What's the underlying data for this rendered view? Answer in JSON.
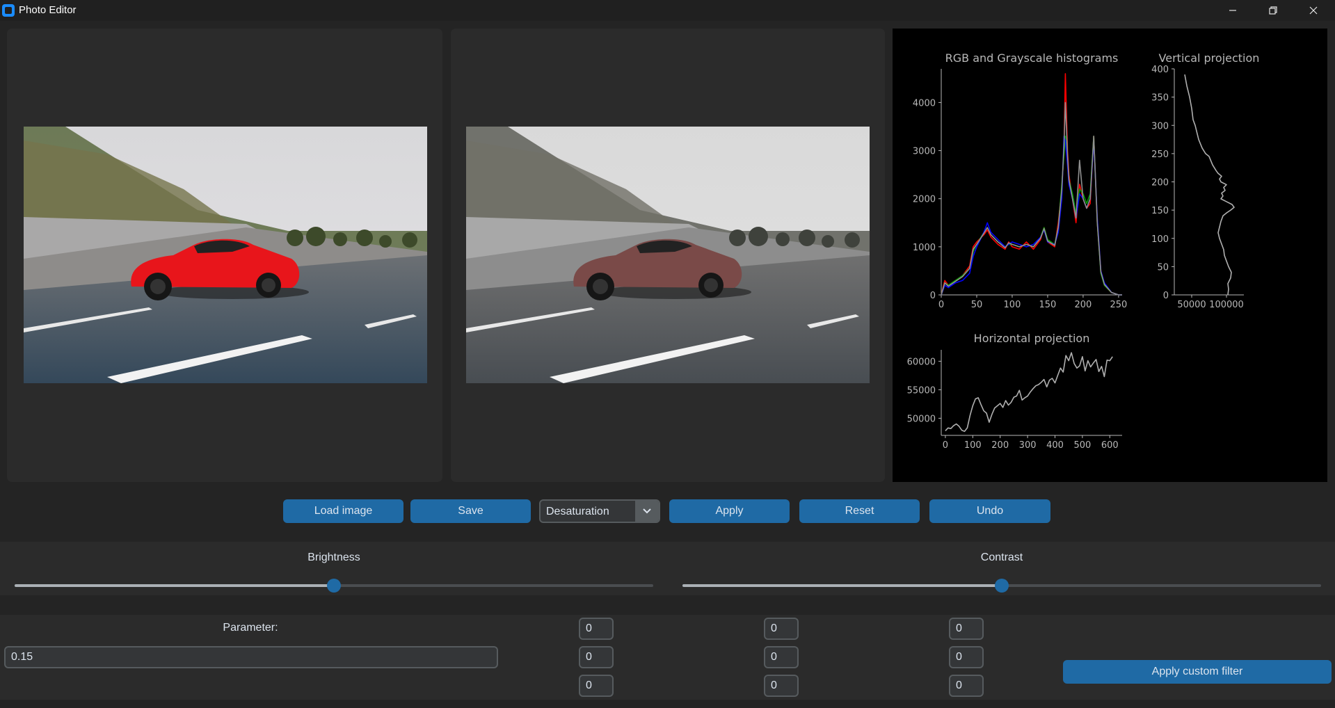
{
  "window": {
    "title": "Photo Editor"
  },
  "toolbar": {
    "load_label": "Load image",
    "save_label": "Save",
    "filter_value": "Desaturation",
    "apply_label": "Apply",
    "reset_label": "Reset",
    "undo_label": "Undo"
  },
  "sliders": {
    "brightness": {
      "label": "Brightness",
      "value": 0.5
    },
    "contrast": {
      "label": "Contrast",
      "value": 0.5
    }
  },
  "custom_filter": {
    "parameter_label": "Parameter:",
    "parameter_value": "0.15",
    "kernel": [
      [
        "0",
        "0",
        "0"
      ],
      [
        "0",
        "0",
        "0"
      ],
      [
        "0",
        "0",
        "0"
      ]
    ],
    "apply_label": "Apply custom filter"
  },
  "colors": {
    "accent": "#1f6aa5",
    "panel": "#2b2b2b",
    "background": "#242424"
  },
  "chart_data": [
    {
      "type": "line",
      "title": "RGB and Grayscale histograms",
      "xticks": [
        "0",
        "50",
        "100",
        "150",
        "200",
        "250"
      ],
      "yticks": [
        "0",
        "1000",
        "2000",
        "3000",
        "4000"
      ],
      "xlim": [
        0,
        255
      ],
      "ylim": [
        0,
        4700
      ],
      "series": [
        {
          "color": "#ff0000",
          "x": [
            0,
            5,
            10,
            20,
            30,
            40,
            45,
            50,
            60,
            65,
            70,
            80,
            90,
            95,
            100,
            110,
            120,
            130,
            140,
            145,
            150,
            160,
            165,
            170,
            173,
            175,
            178,
            180,
            185,
            190,
            195,
            200,
            205,
            210,
            215,
            220,
            225,
            230,
            240,
            250,
            255
          ],
          "y": [
            0,
            300,
            200,
            300,
            400,
            600,
            1000,
            1100,
            1250,
            1350,
            1200,
            1050,
            950,
            1100,
            1000,
            950,
            1100,
            950,
            1150,
            1400,
            1100,
            1000,
            1500,
            2200,
            3000,
            4600,
            3000,
            2500,
            2000,
            1500,
            2300,
            2000,
            1800,
            1900,
            3300,
            1500,
            500,
            200,
            50,
            0,
            0
          ]
        },
        {
          "color": "#00a000",
          "x": [
            0,
            5,
            10,
            20,
            30,
            40,
            45,
            50,
            60,
            65,
            70,
            80,
            90,
            95,
            100,
            110,
            120,
            130,
            140,
            145,
            150,
            160,
            165,
            170,
            173,
            175,
            178,
            180,
            185,
            190,
            195,
            200,
            205,
            210,
            215,
            220,
            225,
            230,
            240,
            250,
            255
          ],
          "y": [
            0,
            250,
            200,
            300,
            400,
            550,
            900,
            1050,
            1300,
            1400,
            1250,
            1100,
            1000,
            1050,
            1050,
            1000,
            1050,
            1000,
            1200,
            1400,
            1150,
            1050,
            1400,
            2300,
            2900,
            3300,
            2800,
            2400,
            2100,
            1700,
            2200,
            2100,
            1900,
            2100,
            3300,
            1500,
            450,
            200,
            50,
            0,
            0
          ]
        },
        {
          "color": "#0000ff",
          "x": [
            0,
            5,
            10,
            20,
            30,
            40,
            45,
            50,
            60,
            65,
            70,
            80,
            90,
            95,
            100,
            110,
            120,
            130,
            140,
            145,
            150,
            160,
            165,
            170,
            173,
            175,
            178,
            180,
            185,
            190,
            195,
            200,
            205,
            210,
            215,
            220,
            225,
            230,
            240,
            250,
            255
          ],
          "y": [
            0,
            200,
            150,
            250,
            300,
            450,
            800,
            1000,
            1300,
            1500,
            1300,
            1150,
            1000,
            1050,
            1100,
            1050,
            1000,
            1050,
            1200,
            1350,
            1100,
            1050,
            1300,
            2000,
            3300,
            3200,
            2700,
            2300,
            2000,
            1600,
            2100,
            2000,
            1800,
            2000,
            3200,
            1600,
            500,
            250,
            50,
            0,
            0
          ]
        },
        {
          "color": "#909090",
          "x": [
            0,
            5,
            10,
            20,
            30,
            40,
            45,
            50,
            60,
            65,
            70,
            80,
            90,
            95,
            100,
            110,
            120,
            130,
            140,
            145,
            150,
            160,
            165,
            170,
            173,
            175,
            178,
            180,
            185,
            190,
            195,
            200,
            205,
            210,
            215,
            220,
            225,
            230,
            240,
            250,
            255
          ],
          "y": [
            0,
            250,
            180,
            280,
            380,
            550,
            950,
            1050,
            1280,
            1400,
            1250,
            1100,
            980,
            1080,
            1050,
            1000,
            1050,
            1000,
            1180,
            1380,
            1120,
            1030,
            1400,
            2200,
            3100,
            4000,
            2900,
            2400,
            2000,
            1600,
            2800,
            2000,
            1800,
            2000,
            3300,
            1500,
            480,
            220,
            50,
            0,
            0
          ]
        }
      ]
    },
    {
      "type": "line",
      "title": "Vertical projection",
      "xticks": [
        "50000",
        "100000"
      ],
      "yticks": [
        "0",
        "50",
        "100",
        "150",
        "200",
        "250",
        "300",
        "350",
        "400"
      ],
      "xlim": [
        25000,
        125000
      ],
      "ylim": [
        0,
        400
      ],
      "series": [
        {
          "color": "#b0b0b0",
          "x": [
            102000,
            103000,
            102000,
            106000,
            107000,
            103000,
            100000,
            97000,
            96000,
            93000,
            90000,
            88000,
            90000,
            92000,
            95000,
            100000,
            106000,
            111000,
            108000,
            100000,
            92000,
            95000,
            93000,
            98000,
            96000,
            100000,
            92000,
            90000,
            93000,
            88000,
            85000,
            80000,
            75000,
            70000,
            65000,
            60000,
            57000,
            55000,
            52000,
            50000,
            47000,
            43000,
            40000
          ],
          "y": [
            0,
            10,
            20,
            30,
            40,
            50,
            60,
            70,
            80,
            90,
            100,
            110,
            120,
            130,
            140,
            145,
            150,
            155,
            160,
            165,
            170,
            175,
            180,
            185,
            190,
            195,
            200,
            205,
            210,
            215,
            220,
            230,
            245,
            250,
            260,
            275,
            290,
            300,
            310,
            330,
            350,
            370,
            390
          ]
        }
      ]
    },
    {
      "type": "line",
      "title": "Horizontal projection",
      "xticks": [
        "0",
        "100",
        "200",
        "300",
        "400",
        "500",
        "600"
      ],
      "yticks": [
        "50000",
        "55000",
        "60000"
      ],
      "xlim": [
        -15,
        645
      ],
      "ylim": [
        47000,
        62000
      ],
      "series": [
        {
          "color": "#b0b0b0",
          "x": [
            0,
            10,
            20,
            30,
            40,
            50,
            60,
            70,
            80,
            90,
            100,
            110,
            120,
            130,
            140,
            150,
            160,
            170,
            180,
            190,
            200,
            210,
            220,
            230,
            240,
            250,
            260,
            270,
            280,
            290,
            300,
            310,
            320,
            330,
            340,
            350,
            360,
            370,
            380,
            390,
            400,
            410,
            420,
            430,
            440,
            450,
            460,
            470,
            480,
            490,
            500,
            510,
            520,
            530,
            540,
            550,
            560,
            570,
            580,
            590,
            600,
            610
          ],
          "y": [
            47800,
            48300,
            48200,
            48700,
            49000,
            48600,
            47900,
            47700,
            48300,
            50500,
            52200,
            53400,
            53600,
            52400,
            51300,
            50900,
            49300,
            50700,
            51800,
            52200,
            52600,
            51900,
            53100,
            52300,
            52800,
            53700,
            53900,
            54900,
            53200,
            53600,
            53900,
            54600,
            55200,
            55700,
            55900,
            56300,
            56800,
            55500,
            56700,
            57000,
            56200,
            57500,
            58800,
            58100,
            61000,
            60100,
            61500,
            59600,
            58800,
            59200,
            60800,
            58300,
            60100,
            59000,
            59700,
            60300,
            58200,
            59100,
            57300,
            60200,
            60100,
            60800
          ]
        }
      ]
    }
  ]
}
